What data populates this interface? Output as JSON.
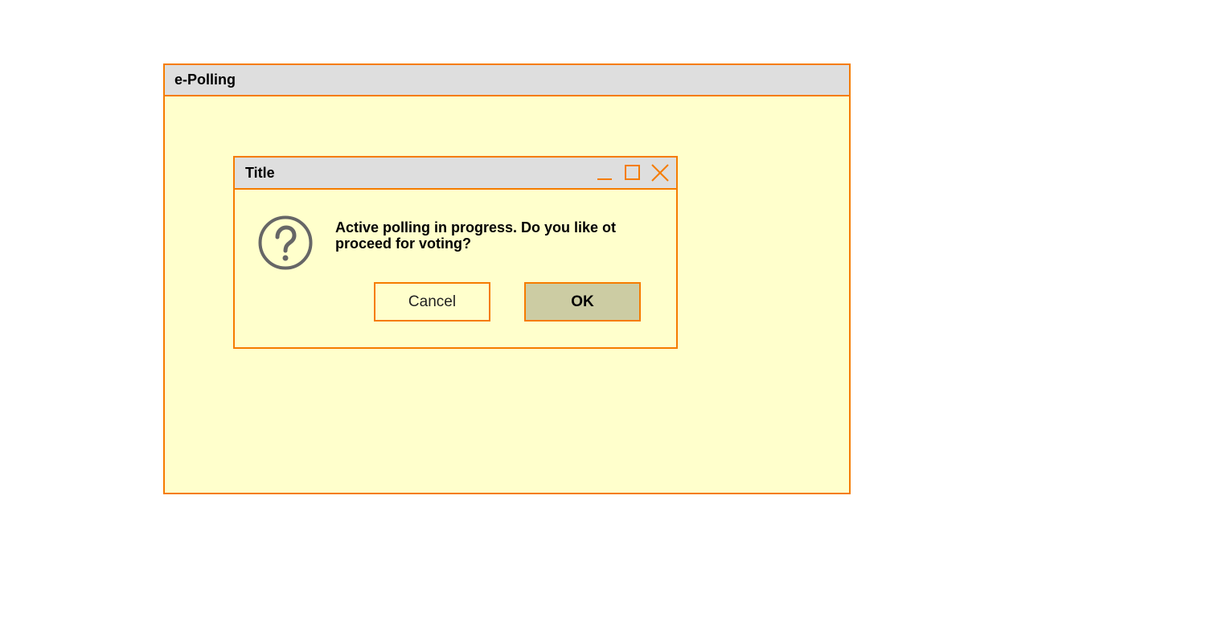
{
  "window": {
    "title": "e-Polling"
  },
  "dialog": {
    "title": "Title",
    "message": "Active polling in progress. Do you like ot proceed for voting?",
    "icon": "question-icon",
    "cancel_label": "Cancel",
    "ok_label": "OK",
    "controls": [
      "minimize-icon",
      "maximize-icon",
      "close-icon"
    ]
  },
  "colors": {
    "accent": "#f57c00",
    "titlebar": "#dedede",
    "window_bg": "#ffffcc",
    "ok_bg": "#cccca3",
    "icon_gray": "#666666"
  }
}
